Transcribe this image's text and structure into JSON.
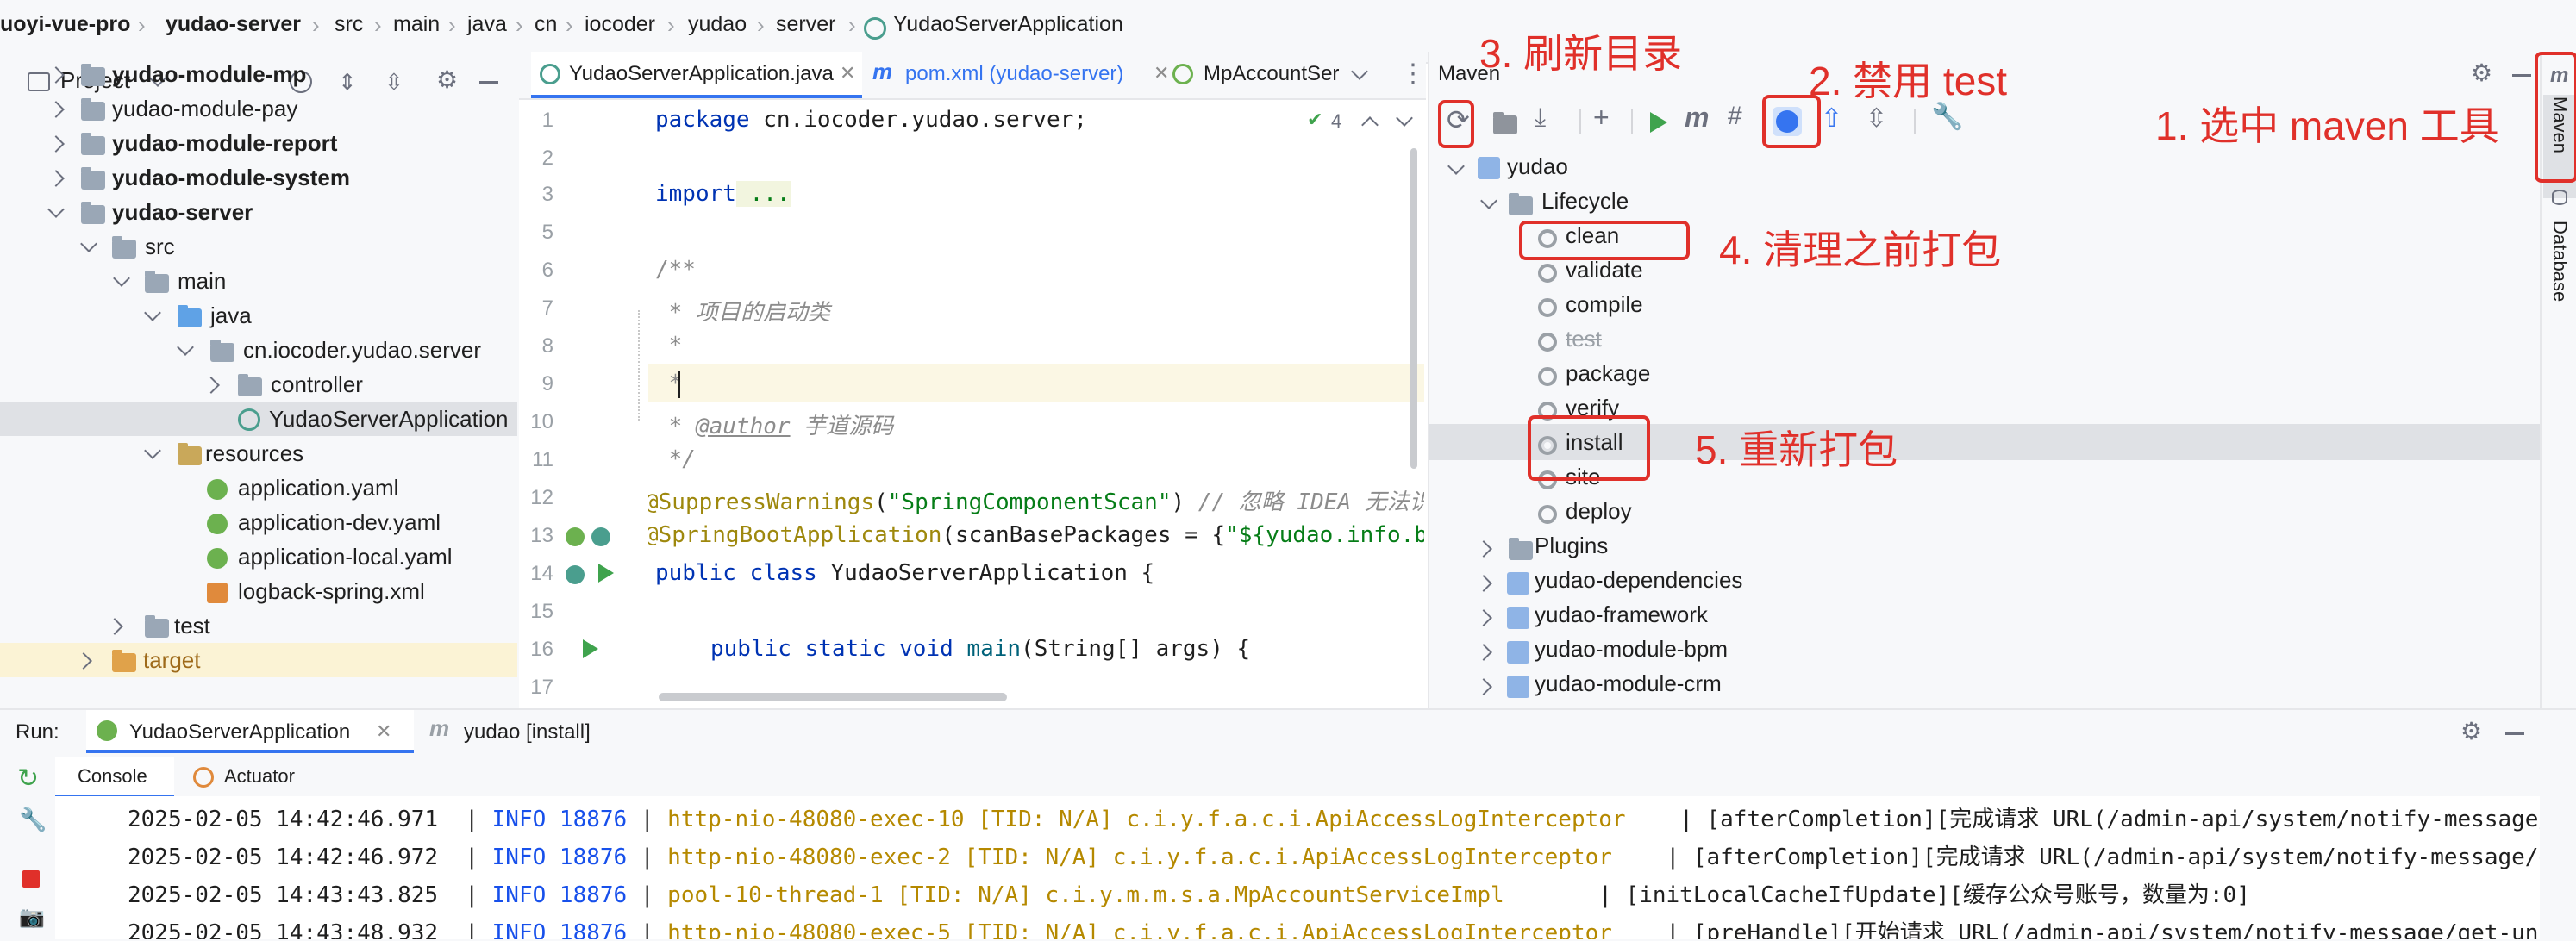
{
  "breadcrumb": [
    "uoyi-vue-pro",
    "yudao-server",
    "src",
    "main",
    "java",
    "cn",
    "iocoder",
    "yudao",
    "server",
    "YudaoServerApplication"
  ],
  "project": {
    "title": "Project",
    "tree": [
      {
        "label": "yudao-module-mp",
        "bold": true
      },
      {
        "label": "yudao-module-pay",
        "bold": false
      },
      {
        "label": "yudao-module-report",
        "bold": true
      },
      {
        "label": "yudao-module-system",
        "bold": true
      },
      {
        "label": "yudao-server",
        "bold": true
      },
      {
        "label": "src"
      },
      {
        "label": "main"
      },
      {
        "label": "java"
      },
      {
        "label": "cn.iocoder.yudao.server"
      },
      {
        "label": "controller"
      },
      {
        "label": "YudaoServerApplication"
      },
      {
        "label": "resources"
      },
      {
        "label": "application.yaml"
      },
      {
        "label": "application-dev.yaml"
      },
      {
        "label": "application-local.yaml"
      },
      {
        "label": "logback-spring.xml"
      },
      {
        "label": "test"
      },
      {
        "label": "target"
      }
    ]
  },
  "editor": {
    "tabs": [
      "YudaoServerApplication.java",
      "pom.xml (yudao-server)",
      "MpAccountSer"
    ],
    "inspection_count": "4",
    "line_numbers": [
      "1",
      "2",
      "3",
      "5",
      "6",
      "7",
      "8",
      "9",
      "10",
      "11",
      "12",
      "13",
      "14",
      "15",
      "16",
      "17"
    ],
    "lines": {
      "l1_kw": "package",
      "l1_rest": " cn.iocoder.yudao.server;",
      "l3_kw": "import",
      "l3_rest": " ...",
      "l6": "/**",
      "l7": " * 项目的启动类",
      "l8": " *",
      "l9": " *",
      "l10_pre": " * ",
      "l10_tag": "@author",
      "l10_rest": " 芋道源码",
      "l11": " */",
      "l12_ann": "@SuppressWarnings",
      "l12_a": "(",
      "l12_str": "\"SpringComponentScan\"",
      "l12_b": ") ",
      "l12_cmt": "// 忽略 IDEA 无法识",
      "l13_ann": "@SpringBootApplication",
      "l13_a": "(scanBasePackages = {",
      "l13_str": "\"${yudao.info.b",
      "l14_kw": "public class",
      "l14_rest": " YudaoServerApplication {",
      "l16_kw": "public static void",
      "l16_fn": " main",
      "l16_rest": "(String[] args) {"
    }
  },
  "maven": {
    "title": "Maven",
    "root": "yudao",
    "lifecycle": "Lifecycle",
    "goals": [
      "clean",
      "validate",
      "compile",
      "test",
      "package",
      "verify",
      "install",
      "site",
      "deploy"
    ],
    "plugins": "Plugins",
    "modules": [
      "yudao-dependencies",
      "yudao-framework",
      "yudao-module-bpm",
      "yudao-module-crm"
    ]
  },
  "annotations": {
    "a1": "1. 选中 maven 工具",
    "a2": "2. 禁用 test",
    "a3": "3. 刷新目录",
    "a4": "4. 清理之前打包",
    "a5": "5. 重新打包"
  },
  "right_strip": {
    "maven": "Maven",
    "database": "Database"
  },
  "run": {
    "label": "Run:",
    "tabs": [
      "YudaoServerApplication",
      "yudao [install]"
    ],
    "subtabs": [
      "Console",
      "Actuator"
    ],
    "logs": [
      {
        "ts": "2025-02-05 14:42:46.971",
        "level": "INFO 18876",
        "thread": "http-nio-48080-exec-10 [TID: N/A]",
        "logger": "c.i.y.f.a.c.i.ApiAccessLogInterceptor",
        "msg": "    | [afterCompletion][完成请求 URL(/admin-api/system/notify-message/"
      },
      {
        "ts": "2025-02-05 14:42:46.972",
        "level": "INFO 18876",
        "thread": "http-nio-48080-exec-2 [TID: N/A]",
        "logger": "c.i.y.f.a.c.i.ApiAccessLogInterceptor",
        "msg": "    | [afterCompletion][完成请求 URL(/admin-api/system/notify-message/g"
      },
      {
        "ts": "2025-02-05 14:43:43.825",
        "level": "INFO 18876",
        "thread": "pool-10-thread-1 [TID: N/A]",
        "logger": "c.i.y.m.m.s.a.MpAccountServiceImpl",
        "msg": "       | [initLocalCacheIfUpdate][缓存公众号账号，数量为:0]"
      },
      {
        "ts": "2025-02-05 14:43:48.932",
        "level": "INFO 18876",
        "thread": "http-nio-48080-exec-5 [TID: N/A]",
        "logger": "c.i.y.f.a.c.i.ApiAccessLogInterceptor",
        "msg": "    | [preHandle][开始请求 URL(/admin-api/system/notify-message/get-unr"
      }
    ]
  },
  "colors": {
    "accent": "#3574f0",
    "annotation": "#e0302a",
    "keyword": "#0033b3",
    "string": "#067d17",
    "annotation_code": "#9e880d",
    "comment": "#8c8c8c"
  }
}
